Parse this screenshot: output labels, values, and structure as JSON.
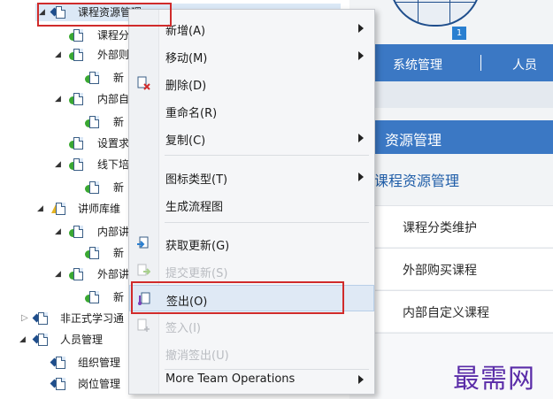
{
  "tree": {
    "items": [
      {
        "label": "课程资源管理",
        "expander": "open",
        "icon": "diamond-page-icon"
      },
      {
        "label": "课程分",
        "expander": "",
        "icon": "green-page-icon"
      },
      {
        "label": "外部则",
        "expander": "open",
        "icon": "green-page-icon"
      },
      {
        "label": "新",
        "expander": "",
        "icon": "green-page-icon"
      },
      {
        "label": "内部自",
        "expander": "open",
        "icon": "green-page-icon"
      },
      {
        "label": "新",
        "expander": "",
        "icon": "green-page-icon"
      },
      {
        "label": "设置求",
        "expander": "",
        "icon": "green-page-icon"
      },
      {
        "label": "线下培",
        "expander": "open",
        "icon": "green-page-icon"
      },
      {
        "label": "新",
        "expander": "",
        "icon": "green-page-icon"
      },
      {
        "label": "讲师库维",
        "expander": "open",
        "icon": "warning-page-icon"
      },
      {
        "label": "内部讲",
        "expander": "open",
        "icon": "green-page-icon"
      },
      {
        "label": "新",
        "expander": "",
        "icon": "green-page-icon"
      },
      {
        "label": "外部讲",
        "expander": "open",
        "icon": "green-page-icon"
      },
      {
        "label": "新",
        "expander": "",
        "icon": "green-page-icon"
      },
      {
        "label": "非正式学习通",
        "expander": "closed",
        "icon": "diamond-page-icon"
      },
      {
        "label": "人员管理",
        "expander": "open",
        "icon": "diamond-page-icon"
      },
      {
        "label": "组织管理",
        "expander": "",
        "icon": "diamond-page-icon"
      },
      {
        "label": "岗位管理",
        "expander": "",
        "icon": "diamond-page-icon"
      }
    ]
  },
  "header": {
    "badge": "1",
    "nav": {
      "system": "系统管理",
      "people": "人员"
    }
  },
  "panel": {
    "section_title": "资源管理",
    "course_title": "课程资源管理",
    "items": [
      "课程分类维护",
      "外部购买课程",
      "内部自定义课程"
    ]
  },
  "watermark": "最需网",
  "context_menu": {
    "items": [
      {
        "label": "新增(A)",
        "submenu": true,
        "disabled": false,
        "icon": ""
      },
      {
        "label": "移动(M)",
        "submenu": true,
        "disabled": false,
        "icon": ""
      },
      {
        "label": "删除(D)",
        "submenu": false,
        "disabled": false,
        "icon": "delete-page-icon"
      },
      {
        "label": "重命名(R)",
        "submenu": false,
        "disabled": false,
        "icon": ""
      },
      {
        "label": "复制(C)",
        "submenu": true,
        "disabled": false,
        "icon": ""
      },
      {
        "label": "图标类型(T)",
        "submenu": true,
        "disabled": false,
        "icon": ""
      },
      {
        "label": "生成流程图",
        "submenu": false,
        "disabled": false,
        "icon": ""
      },
      {
        "label": "获取更新(G)",
        "submenu": false,
        "disabled": false,
        "icon": "get-update-icon"
      },
      {
        "label": "提交更新(S)",
        "submenu": false,
        "disabled": true,
        "icon": "submit-update-icon"
      },
      {
        "label": "签出(O)",
        "submenu": false,
        "disabled": false,
        "icon": "checkout-icon"
      },
      {
        "label": "签入(I)",
        "submenu": false,
        "disabled": true,
        "icon": "checkin-icon"
      },
      {
        "label": "撤消签出(U)",
        "submenu": false,
        "disabled": true,
        "icon": ""
      },
      {
        "label": "More Team Operations",
        "submenu": true,
        "disabled": false,
        "icon": ""
      }
    ]
  },
  "colors": {
    "accent_blue": "#3b78c4",
    "highlight_red": "#d02b2b",
    "watermark_purple": "#5a2ca8",
    "node_green": "#3aa832"
  }
}
